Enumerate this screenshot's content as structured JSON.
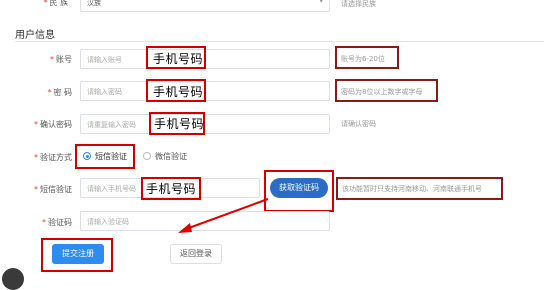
{
  "top": {
    "ethnicity_label": "民 族",
    "ethnicity_value": "汉族",
    "ethnicity_hint": "请选择民族"
  },
  "section_title": "用户信息",
  "fields": {
    "account": {
      "label": "账号",
      "placeholder": "请输入账号",
      "overlay": "手机号码",
      "hint": "账号为6-20位"
    },
    "password": {
      "label": "密 码",
      "placeholder": "请输入密码",
      "overlay": "手机号码",
      "hint": "密码为8位以上数字或字母"
    },
    "confirm": {
      "label": "确认密码",
      "placeholder": "请重复输入密码",
      "overlay": "手机号码",
      "hint": "请确认密码"
    },
    "verify_method": {
      "label": "验证方式",
      "option1": "短信验证",
      "option2": "微信验证"
    },
    "sms": {
      "label": "短信验证",
      "placeholder": "请输入手机号码",
      "overlay": "手机号码",
      "button": "获取验证码",
      "hint": "该功能暂时只支持河南移动、河南联通手机号"
    },
    "code": {
      "label": "验证码",
      "placeholder": "请输入验证码"
    }
  },
  "buttons": {
    "submit": "提交注册",
    "back": "返回登录"
  },
  "colors": {
    "red": "#d40000",
    "blue": "#2d8cf0",
    "darkred": "#8a1a1a"
  }
}
